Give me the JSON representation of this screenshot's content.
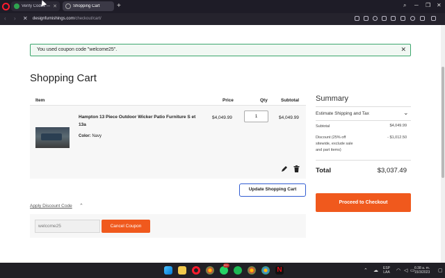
{
  "browser": {
    "tabs": [
      {
        "label": "Verify Codes — Simpl"
      },
      {
        "label": "Shopping Cart"
      }
    ],
    "url_host": "designfurnishings.com",
    "url_path": "/checkout/cart/"
  },
  "alert": {
    "message": "You used coupon code \"welcome25\"."
  },
  "page_title": "Shopping Cart",
  "cart": {
    "headers": {
      "item": "Item",
      "price": "Price",
      "qty": "Qty",
      "subtotal": "Subtotal"
    },
    "item": {
      "name": "Hampton 13 Piece Outdoor Wicker Patio Furniture S et 13a",
      "color_label": "Color:",
      "color_value": "Navy",
      "price": "$4,049.99",
      "qty": "1",
      "subtotal": "$4,049.99"
    },
    "update_label": "Update Shopping Cart"
  },
  "discount": {
    "link_label": "Apply Discount Code",
    "code_value": "welcome25",
    "cancel_label": "Cancel Coupon"
  },
  "summary": {
    "title": "Summary",
    "shipping_label": "Estimate Shipping and Tax",
    "subtotal_label": "Subtotal",
    "subtotal_value": "$4,049.99",
    "discount_label_1": "Discount (25% off",
    "discount_label_2": "sitewide, exclude sale",
    "discount_label_3": "and part items)",
    "discount_value": "- $1,012.50",
    "total_label": "Total",
    "total_value": "$3,037.49",
    "checkout_label": "Proceed to Checkout"
  },
  "taskbar": {
    "lang_1": "ESP",
    "lang_2": "LAA",
    "time": "6:38 a. m.",
    "date": "15/3/2023",
    "badge": "99+"
  },
  "colors": {
    "accent": "#f0591d",
    "success": "#3aa56b",
    "focus": "#2f5bd1"
  }
}
